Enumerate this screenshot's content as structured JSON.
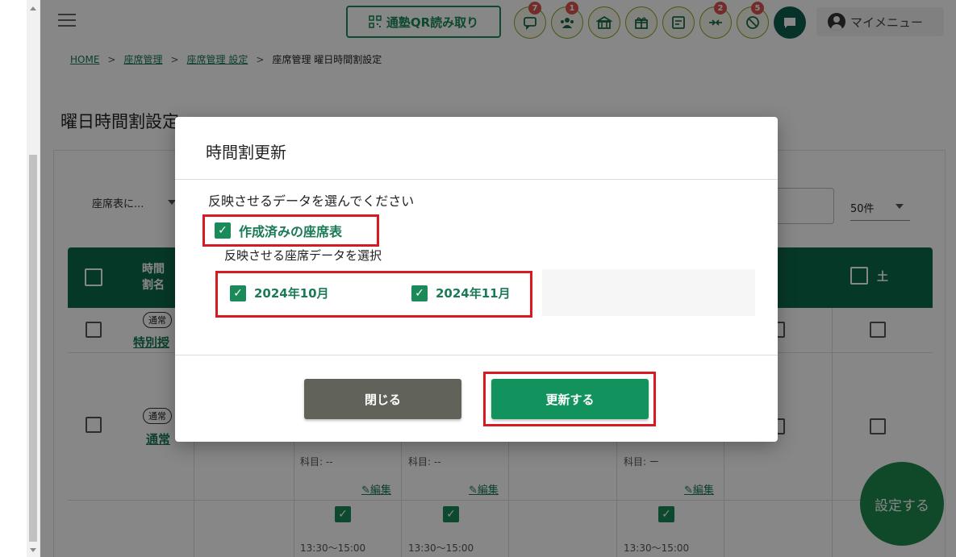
{
  "header": {
    "qr_button_label": "通塾QR読み取り",
    "icons": [
      {
        "name": "message-icon",
        "badge": "7"
      },
      {
        "name": "group-icon",
        "badge": "1"
      },
      {
        "name": "school-icon",
        "badge": ""
      },
      {
        "name": "gift-icon",
        "badge": ""
      },
      {
        "name": "report-icon",
        "badge": ""
      },
      {
        "name": "exchange-icon",
        "badge": "2"
      },
      {
        "name": "blocked-icon",
        "badge": "5"
      }
    ],
    "menu_label": "マイメニュー"
  },
  "breadcrumb": {
    "items": [
      "HOME",
      "座席管理",
      "座席管理 設定",
      "座席管理 曜日時間割設定"
    ],
    "separator": ">"
  },
  "page": {
    "title": "曜日時間割設定",
    "seat_select_value": "座席表に...",
    "per_page_value": "50件",
    "table": {
      "col_name_header": "時間割名",
      "col_sat_header": "土",
      "rows": [
        {
          "tag": "通常",
          "name": "特別授"
        },
        {
          "tag": "通常",
          "name": "通常"
        }
      ],
      "cell_subject": "科目: --",
      "cell_subject_alt": "科目: --",
      "cell_subject_3": "科目: ー",
      "edit_label": "編集",
      "time_label": "13:30〜15:00"
    },
    "fab_label": "設定する"
  },
  "modal": {
    "title": "時間割更新",
    "instruction": "反映させるデータを選んでください",
    "created_option_label": "作成済みの座席表",
    "select_data_label": "反映させる座席データを選択",
    "months": [
      "2024年10月",
      "2024年11月"
    ],
    "close_label": "閉じる",
    "update_label": "更新する"
  },
  "colors": {
    "brand_green": "#1a8a5a",
    "table_header": "#0d6b4d",
    "highlight_red": "#d71921",
    "close_gray": "#616259"
  }
}
